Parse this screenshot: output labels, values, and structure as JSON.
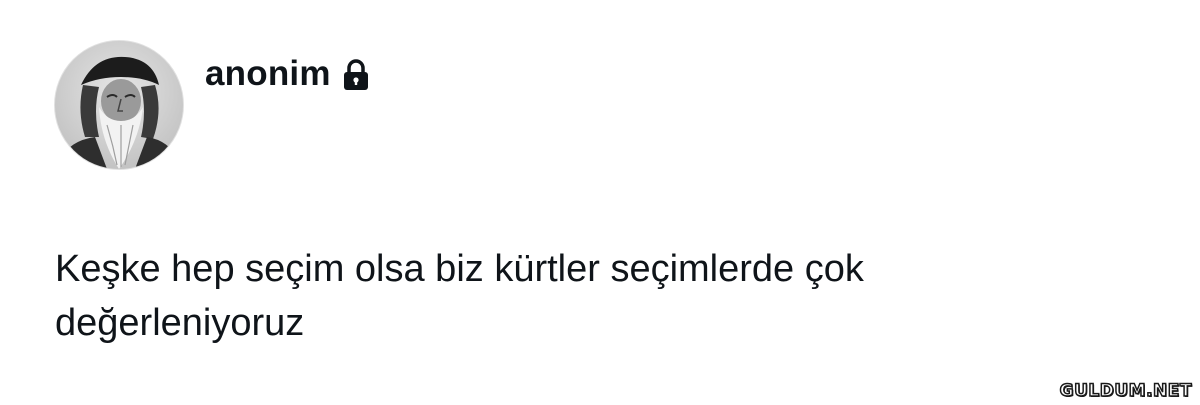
{
  "profile": {
    "display_name": "anonim",
    "avatar_icon": "portrait-avatar",
    "protected_icon": "lock-icon"
  },
  "tweet": {
    "line1": "Keşke hep seçim olsa biz kürtler seçimlerde çok",
    "line2": "değerleniyoruz"
  },
  "watermark": {
    "text": "GULDUM.NET"
  },
  "colors": {
    "text": "#0f1419",
    "background": "#ffffff"
  }
}
